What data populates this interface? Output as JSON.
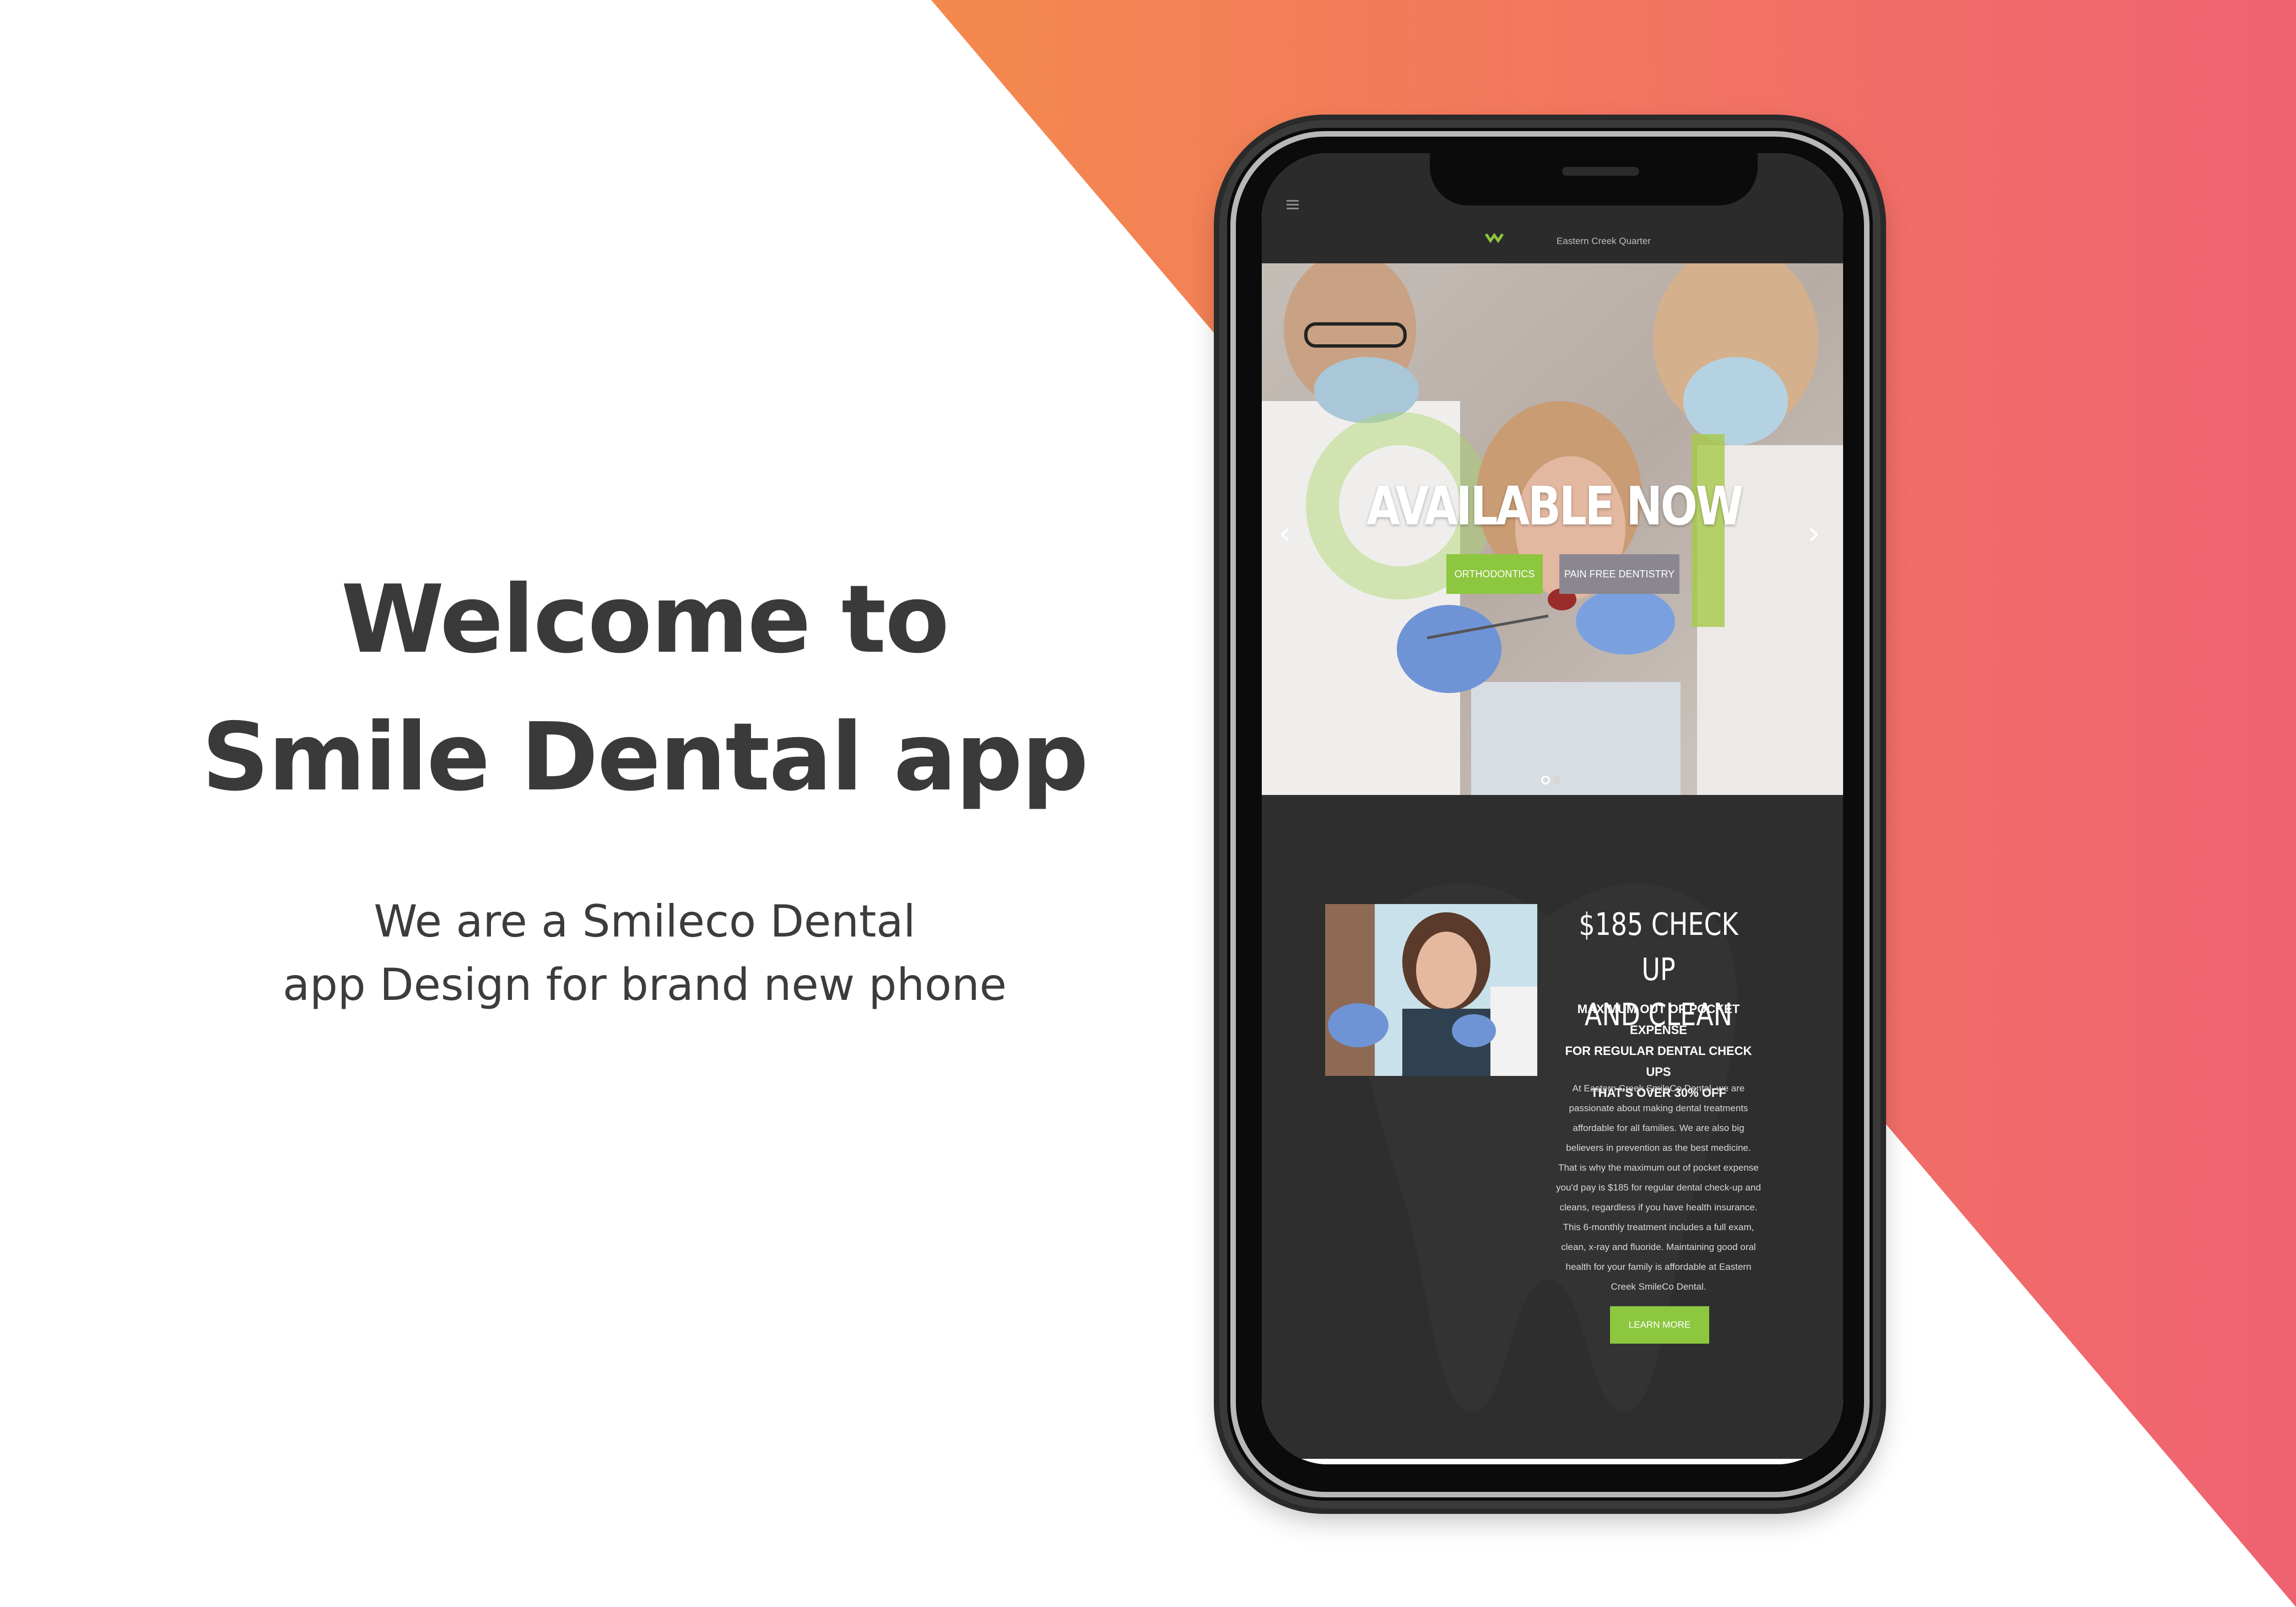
{
  "colors": {
    "gradient_start": "#f4894e",
    "gradient_end": "#ef6272",
    "accent_green": "#8dc63f",
    "dark_bg": "#2e2e2e"
  },
  "intro": {
    "heading_line1": "Welcome to",
    "heading_line2": "Smile Dental app",
    "sub_line1": "We are a Smileco Dental",
    "sub_line2": "app Design for brand new phone"
  },
  "app": {
    "menu_icon": "hamburger-icon",
    "logo_text": "Eastern Creek Quarter",
    "hero": {
      "title": "AVAILABLE NOW",
      "buttons": [
        "ORTHODONTICS",
        "PAIN FREE DENTISTRY"
      ],
      "prev_icon": "chevron-left-icon",
      "next_icon": "chevron-right-icon"
    },
    "promo": {
      "title_line1": "$185 CHECK UP",
      "title_line2": "AND CLEAN",
      "sub_line1": "MAXIMUM OUT OF POCKET EXPENSE",
      "sub_line2": "FOR REGULAR DENTAL CHECK UPS",
      "sub_line3": "THAT'S OVER 30% OFF",
      "body_lines": [
        "At Eastern Creek SmileCo Dental, we are",
        "passionate about making dental treatments",
        "affordable for all families. We are also big",
        "believers in prevention as the best medicine.",
        "That is why the maximum out of pocket expense",
        "you'd pay is $185 for regular dental check-up and",
        "cleans, regardless if you have health insurance.",
        "This 6-monthly treatment includes a full exam,",
        "clean, x-ray and fluoride. Maintaining good oral",
        "health for your family is affordable at Eastern",
        "Creek SmileCo Dental."
      ],
      "cta": "LEARN MORE"
    }
  }
}
